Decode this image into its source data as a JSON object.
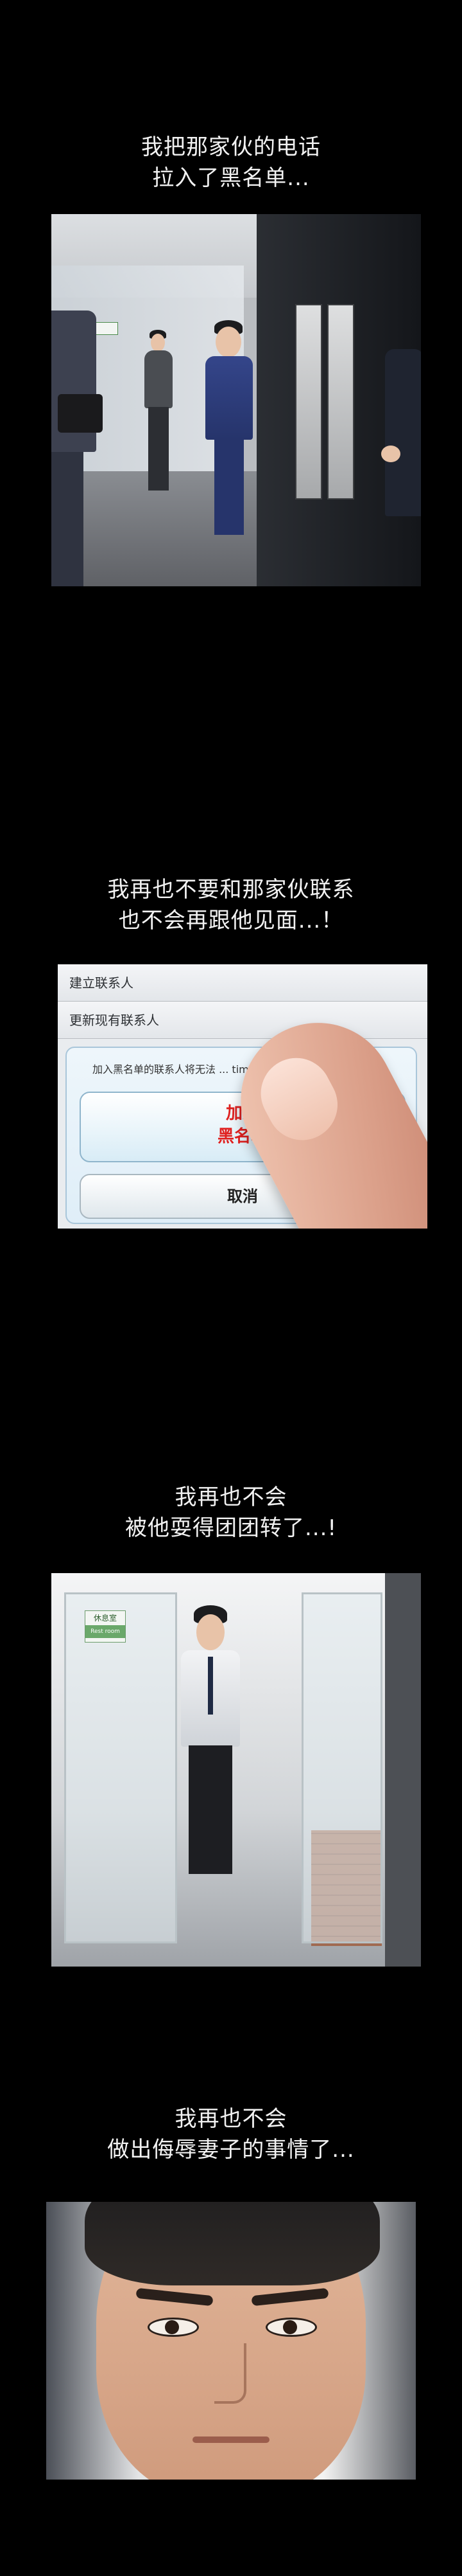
{
  "captions": [
    {
      "line1": "我把那家伙的电话",
      "line2": "拉入了黑名单..."
    },
    {
      "line1": "我再也不要和那家伙联系",
      "line2": "也不会再跟他见面...！"
    },
    {
      "line1": "我再也不会",
      "line2": "被他耍得团团转了...!"
    },
    {
      "line1": "我再也不会",
      "line2": "做出侮辱妻子的事情了..."
    }
  ],
  "phone_menu": {
    "row1": "建立联系人",
    "row2": "更新现有联系人",
    "dialog_message": "加入黑名单的联系人将无法 ... time功能",
    "add_button_line1": "加入",
    "add_button_line2": "黑名单",
    "cancel_button": "取消"
  },
  "door_sign": {
    "title": "休息室",
    "subtitle": "Rest room"
  }
}
